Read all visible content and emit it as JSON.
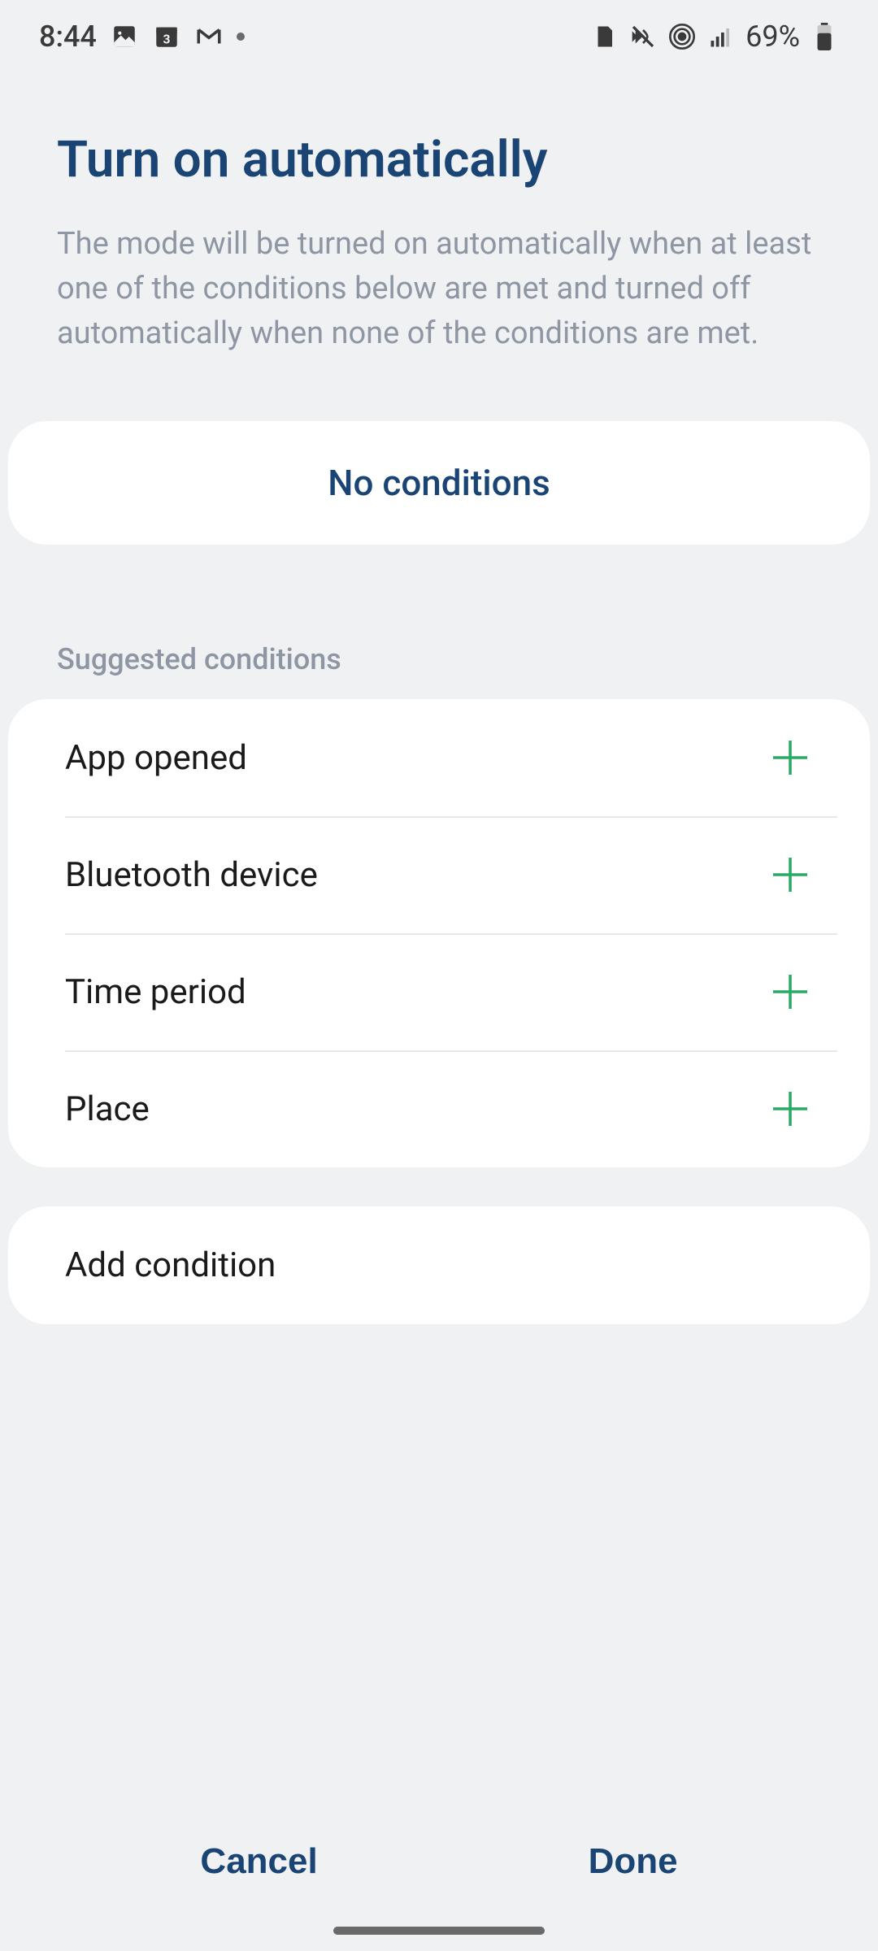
{
  "status": {
    "time": "8:44",
    "battery": "69%"
  },
  "header": {
    "title": "Turn on automatically",
    "description": "The mode will be turned on automatically when at least one of the conditions below are met and turned off automatically when none of the conditions are met."
  },
  "conditions_card": {
    "empty_label": "No conditions"
  },
  "suggestions": {
    "header": "Suggested conditions",
    "items": [
      {
        "label": "App opened"
      },
      {
        "label": "Bluetooth device"
      },
      {
        "label": "Time period"
      },
      {
        "label": "Place"
      }
    ]
  },
  "add_condition": {
    "label": "Add condition"
  },
  "buttons": {
    "cancel": "Cancel",
    "done": "Done"
  }
}
